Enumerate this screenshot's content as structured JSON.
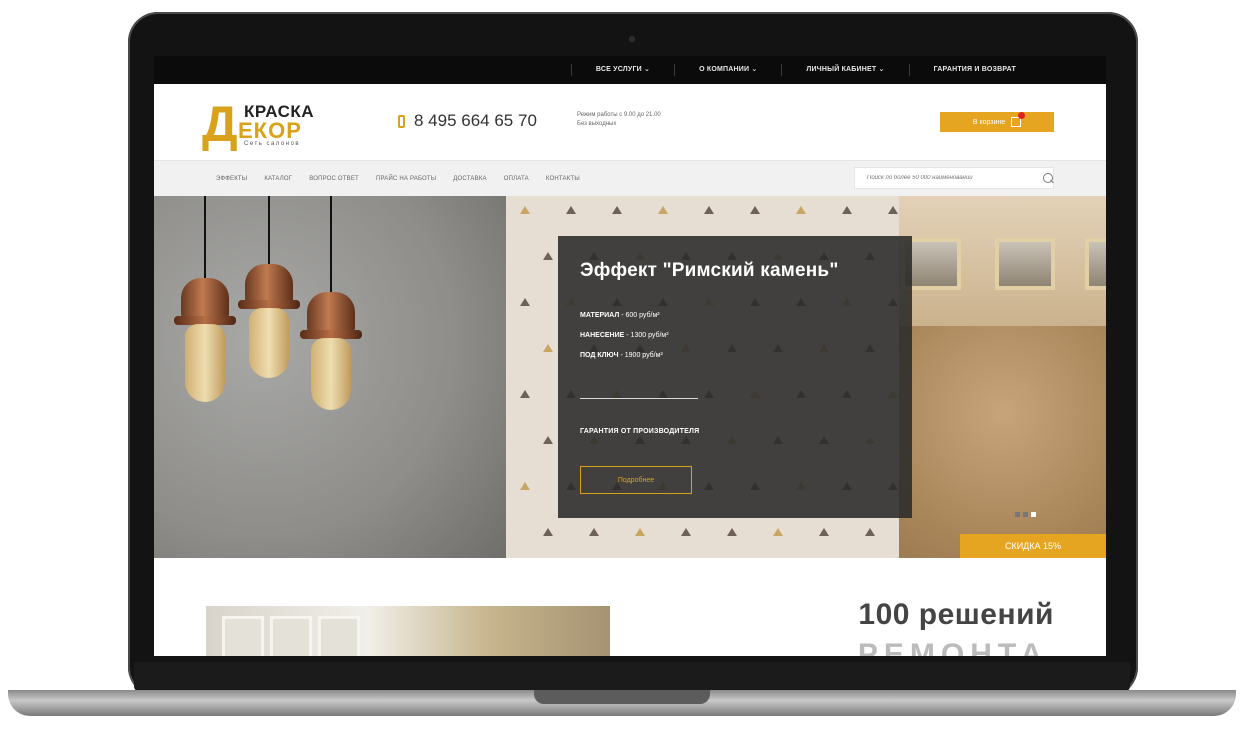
{
  "topnav": [
    "ВСЕ УСЛУГИ ⌄",
    "О КОМПАНИИ ⌄",
    "ЛИЧНЫЙ КАБИНЕТ ⌄",
    "ГАРАНТИЯ И ВОЗВРАТ"
  ],
  "header": {
    "logo_line1": "КРАСКА",
    "logo_letter": "Д",
    "logo_line2": "ЕКОР",
    "logo_tagline": "Сеть салонов",
    "phone": "8 495 664 65 70",
    "hours_line1": "Режим работы с 9.00 до 21.00",
    "hours_line2": "Без выходных",
    "cart_label": "В корзине"
  },
  "nav": [
    "ЭФФЕКТЫ",
    "КАТАЛОГ",
    "ВОПРОС ОТВЕТ",
    "ПРАЙС НА РАБОТЫ",
    "ДОСТАВКА",
    "ОПЛАТА",
    "КОНТАКТЫ"
  ],
  "search": {
    "placeholder": "Поиск по более 50 000 наименований"
  },
  "promo": {
    "title": "Эффект \"Римский камень\"",
    "lines": [
      {
        "label": "МАТЕРИАЛ",
        "value": " - 600 руб/м²"
      },
      {
        "label": "НАНЕСЕНИЕ",
        "value": " - 1300 руб/м²"
      },
      {
        "label": "ПОД КЛЮЧ",
        "value": " - 1900 руб/м²"
      }
    ],
    "guarantee": "ГАРАНТИЯ ОТ ПРОИЗВОДИТЕЛЯ",
    "button": "Подробнее"
  },
  "discount": "СКИДКА 15%",
  "section": {
    "heading": "100 решений",
    "heading2": "РЕМОНТА"
  },
  "colors": {
    "accent": "#e6a520",
    "dark": "#0b0b0b",
    "promo_bg": "#2a2a2a"
  }
}
